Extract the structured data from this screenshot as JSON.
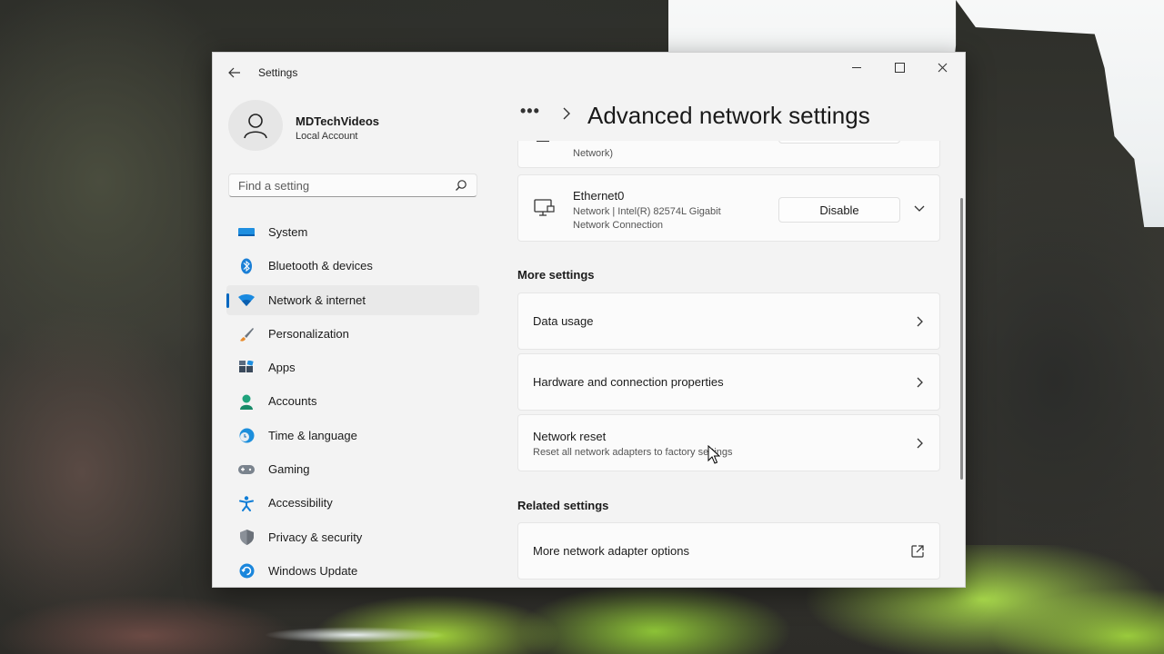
{
  "window": {
    "title": "Settings"
  },
  "profile": {
    "name": "MDTechVideos",
    "account_type": "Local Account"
  },
  "search": {
    "placeholder": "Find a setting"
  },
  "nav": {
    "items": [
      {
        "label": "System",
        "icon": "monitor-icon",
        "color": "#0078d4"
      },
      {
        "label": "Bluetooth & devices",
        "icon": "bluetooth-icon",
        "color": "#0078d4"
      },
      {
        "label": "Network & internet",
        "icon": "wifi-icon",
        "color": "#0067c0",
        "selected": true
      },
      {
        "label": "Personalization",
        "icon": "brush-icon",
        "color": "#e08a2c"
      },
      {
        "label": "Apps",
        "icon": "apps-icon",
        "color": "#4a6a8a"
      },
      {
        "label": "Accounts",
        "icon": "person-icon",
        "color": "#1fa37c"
      },
      {
        "label": "Time & language",
        "icon": "globe-clock-icon",
        "color": "#0f8fd6"
      },
      {
        "label": "Gaming",
        "icon": "gamepad-icon",
        "color": "#6e7782"
      },
      {
        "label": "Accessibility",
        "icon": "accessibility-icon",
        "color": "#0f7dd6"
      },
      {
        "label": "Privacy & security",
        "icon": "shield-icon",
        "color": "#7a8088"
      },
      {
        "label": "Windows Update",
        "icon": "update-icon",
        "color": "#0f7dd6"
      }
    ]
  },
  "breadcrumb": {
    "overflow": "•••",
    "title": "Advanced network settings"
  },
  "adapters": {
    "partial_sub": "Network)",
    "ethernet": {
      "name": "Ethernet0",
      "desc_line1": "Network | Intel(R) 82574L Gigabit",
      "desc_line2": "Network Connection",
      "button": "Disable"
    }
  },
  "more_settings": {
    "heading": "More settings",
    "items": [
      {
        "title": "Data usage"
      },
      {
        "title": "Hardware and connection properties"
      },
      {
        "title": "Network reset",
        "subtitle": "Reset all network adapters to factory settings"
      }
    ]
  },
  "related_settings": {
    "heading": "Related settings",
    "items": [
      {
        "title": "More network adapter options"
      }
    ]
  },
  "colors": {
    "accent": "#0067c0",
    "window_bg": "#f3f3f3",
    "card_bg": "#fbfbfb"
  }
}
